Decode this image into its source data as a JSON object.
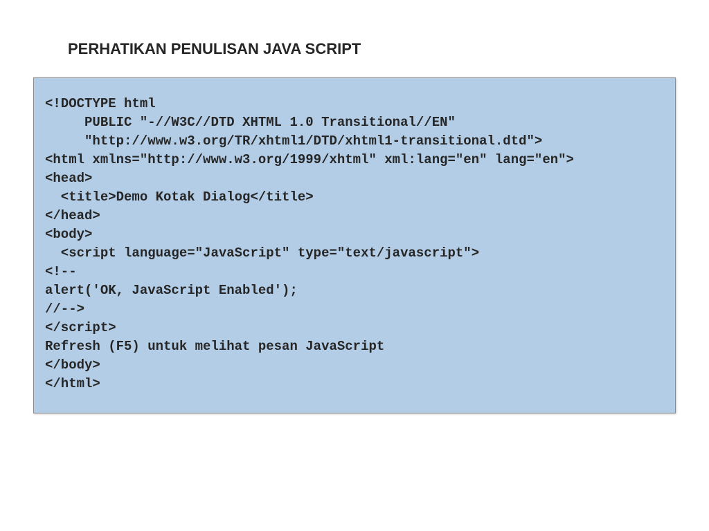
{
  "title": "PERHATIKAN PENULISAN JAVA SCRIPT",
  "code": {
    "line1": "<!DOCTYPE html",
    "line2": "     PUBLIC \"-//W3C//DTD XHTML 1.0 Transitional//EN\"",
    "line3": "     \"http://www.w3.org/TR/xhtml1/DTD/xhtml1-transitional.dtd\">",
    "line4": "<html xmlns=\"http://www.w3.org/1999/xhtml\" xml:lang=\"en\" lang=\"en\">",
    "line5": "",
    "line6": "<head>",
    "line7": "  <title>Demo Kotak Dialog</title>",
    "line8": "</head>",
    "line9": "",
    "line10": "<body>",
    "line11": "  <script language=\"JavaScript\" type=\"text/javascript\">",
    "line12": "<!--",
    "line13": "alert('OK, JavaScript Enabled');",
    "line14": "//-->",
    "line15": "</script>",
    "line16": "",
    "line17": "Refresh (F5) untuk melihat pesan JavaScript",
    "line18": "</body>",
    "line19": "</html>"
  }
}
